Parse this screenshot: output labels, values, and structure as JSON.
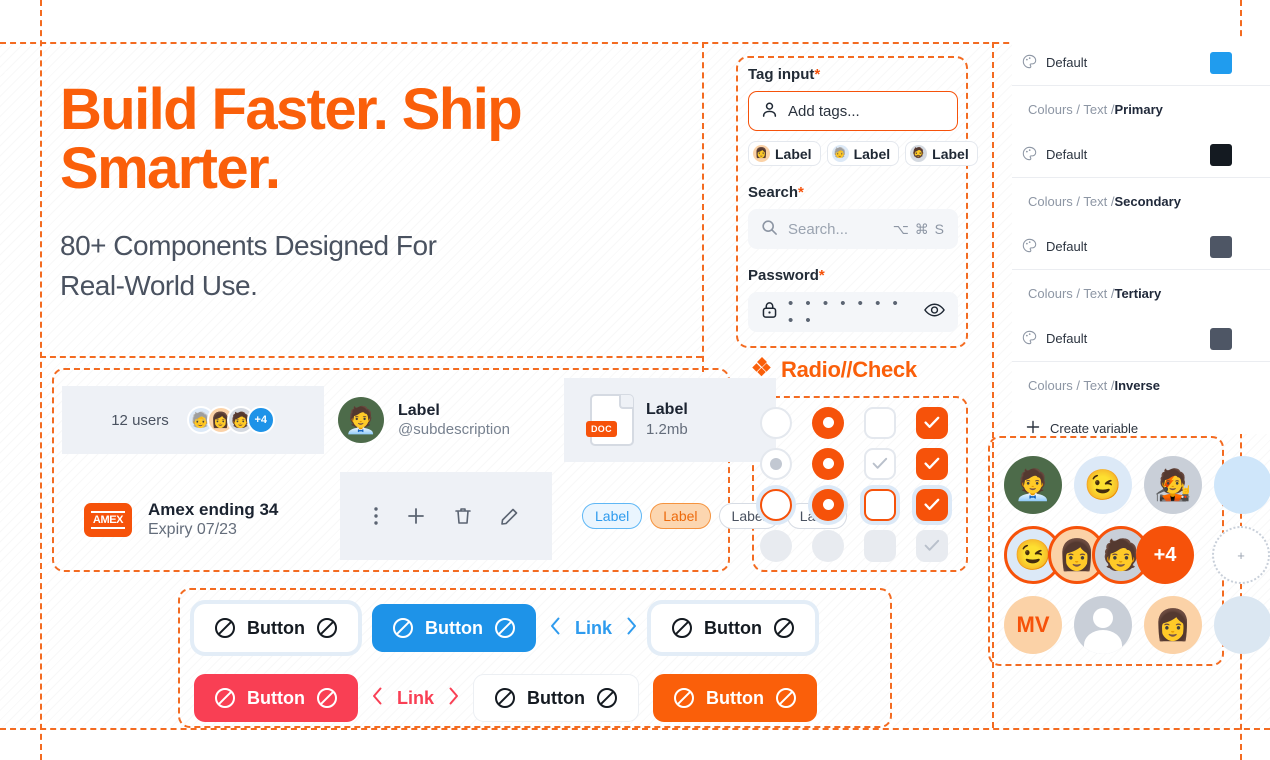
{
  "hero": {
    "headline_line1": "Build Faster. Ship",
    "headline_line2": "Smarter.",
    "sub_line1": "80+ Components Designed For",
    "sub_line2": "Real-World Use.",
    "accent": "#fa5f0a"
  },
  "cards": {
    "users_count_label": "12 users",
    "users_overflow": "+4",
    "user_row": {
      "label": "Label",
      "sub": "@subdescription"
    },
    "doc_row": {
      "label": "Label",
      "size": "1.2mb",
      "file_type": "DOC"
    },
    "payment_row": {
      "label": "Amex ending 34",
      "sub": "Expiry 07/23",
      "brand": "AMEX"
    },
    "action_icons": [
      "more-vertical-icon",
      "plus-icon",
      "trash-icon",
      "pencil-icon"
    ],
    "tags": [
      {
        "text": "Label",
        "style": "blue"
      },
      {
        "text": "Label",
        "style": "orange"
      },
      {
        "text": "Label",
        "style": "plain"
      },
      {
        "text": "Label",
        "style": "plain"
      }
    ]
  },
  "forms": {
    "tag_input": {
      "label": "Tag input",
      "required_mark": "*",
      "placeholder": "Add tags...",
      "chips": [
        {
          "text": "Label",
          "avatar": "avatar-woman-1"
        },
        {
          "text": "Label",
          "avatar": "avatar-man-2"
        },
        {
          "text": "Label",
          "avatar": "avatar-man-3"
        }
      ]
    },
    "search": {
      "label": "Search",
      "required_mark": "*",
      "placeholder": "Search...",
      "shortcut": "⌥ ⌘ S"
    },
    "password": {
      "label": "Password",
      "required_mark": "*",
      "value": "• • • • • • • • •"
    }
  },
  "radio_check": {
    "title": "Radio//Check",
    "title_icon": "diamonds-icon",
    "rows": [
      [
        "radio-unchecked",
        "radio-checked",
        "checkbox-unchecked",
        "checkbox-checked"
      ],
      [
        "radio-dot",
        "radio-checked",
        "checkbox-check-gray",
        "checkbox-checked"
      ],
      [
        "radio-focus-ring",
        "radio-checked-focus-ring",
        "checkbox-focus-ring",
        "checkbox-checked-focus-ring"
      ],
      [
        "radio-disabled",
        "radio-disabled",
        "checkbox-disabled",
        "checkbox-disabled-check"
      ]
    ]
  },
  "buttons": {
    "row1": [
      {
        "type": "button",
        "label": "Button",
        "variant": "white"
      },
      {
        "type": "button",
        "label": "Button",
        "variant": "blue"
      },
      {
        "type": "link",
        "label": "Link",
        "variant": "blue"
      },
      {
        "type": "button",
        "label": "Button",
        "variant": "white"
      }
    ],
    "row2": [
      {
        "type": "button",
        "label": "Button",
        "variant": "red"
      },
      {
        "type": "link",
        "label": "Link",
        "variant": "red"
      },
      {
        "type": "button",
        "label": "Button",
        "variant": "plain"
      },
      {
        "type": "button",
        "label": "Button",
        "variant": "orange"
      }
    ],
    "leading_icon": "no-entry-icon",
    "trailing_icon": "no-entry-icon",
    "link_prev_icon": "chevron-left-icon",
    "link_next_icon": "chevron-right-icon"
  },
  "variables_panel": {
    "rows": [
      {
        "kind": "item",
        "name": "Default",
        "swatch": "#209cee",
        "icon": "palette-icon"
      },
      {
        "kind": "group",
        "prefix": "Colours / Text / ",
        "name": "Primary"
      },
      {
        "kind": "item",
        "name": "Default",
        "swatch": "#141a21",
        "icon": "palette-icon"
      },
      {
        "kind": "group",
        "prefix": "Colours / Text / ",
        "name": "Secondary"
      },
      {
        "kind": "item",
        "name": "Default",
        "swatch": "#4e5665",
        "icon": "palette-icon"
      },
      {
        "kind": "group",
        "prefix": "Colours / Text / ",
        "name": "Tertiary"
      },
      {
        "kind": "item",
        "name": "Default",
        "swatch": "#4e5665",
        "icon": "palette-icon"
      },
      {
        "kind": "group",
        "prefix": "Colours / Text / ",
        "name": "Inverse"
      }
    ],
    "create_label": "Create variable",
    "create_icon": "plus-icon"
  },
  "avatars": {
    "row1": [
      "avatar-photo-man",
      "avatar-memoji-wink",
      "avatar-illustration-man",
      "avatar-blue-partial"
    ],
    "row2_overflow": "+4",
    "row3_initials": "MV",
    "row3_placeholder": "avatar-silhouette"
  }
}
